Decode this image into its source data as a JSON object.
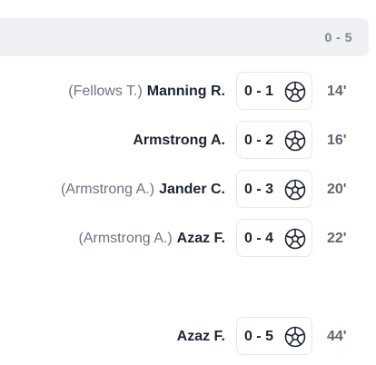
{
  "header": {
    "score": "0 - 5"
  },
  "events": [
    {
      "assist": "(Fellows T.)",
      "scorer": "Manning R.",
      "score": "0 - 1",
      "icon": "soccer-ball-icon",
      "minute": "14'"
    },
    {
      "assist": "",
      "scorer": "Armstrong A.",
      "score": "0 - 2",
      "icon": "soccer-ball-icon",
      "minute": "16'"
    },
    {
      "assist": "(Armstrong A.)",
      "scorer": "Jander C.",
      "score": "0 - 3",
      "icon": "soccer-ball-icon",
      "minute": "20'"
    },
    {
      "assist": "(Armstrong A.)",
      "scorer": "Azaz F.",
      "score": "0 - 4",
      "icon": "soccer-ball-icon",
      "minute": "22'"
    },
    {
      "assist": "",
      "scorer": "Azaz F.",
      "score": "0 - 5",
      "icon": "soccer-ball-icon",
      "minute": "44'"
    }
  ]
}
